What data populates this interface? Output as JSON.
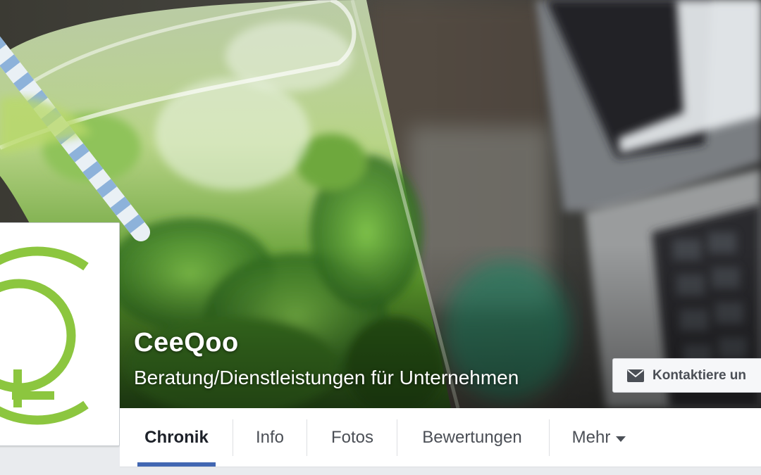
{
  "page": {
    "name": "CeeQoo",
    "category": "Beratung/Dienstleistungen für Unternehmen"
  },
  "contact_button": {
    "label": "Kontaktiere un",
    "icon": "envelope-icon"
  },
  "tabs": [
    {
      "label": "Chronik",
      "active": true
    },
    {
      "label": "Info",
      "active": false
    },
    {
      "label": "Fotos",
      "active": false
    },
    {
      "label": "Bewertungen",
      "active": false
    },
    {
      "label": "Mehr",
      "active": false,
      "icon": "chevron-down-icon"
    }
  ],
  "colors": {
    "accent": "#4267b2",
    "logo_green": "#8cc63f"
  }
}
